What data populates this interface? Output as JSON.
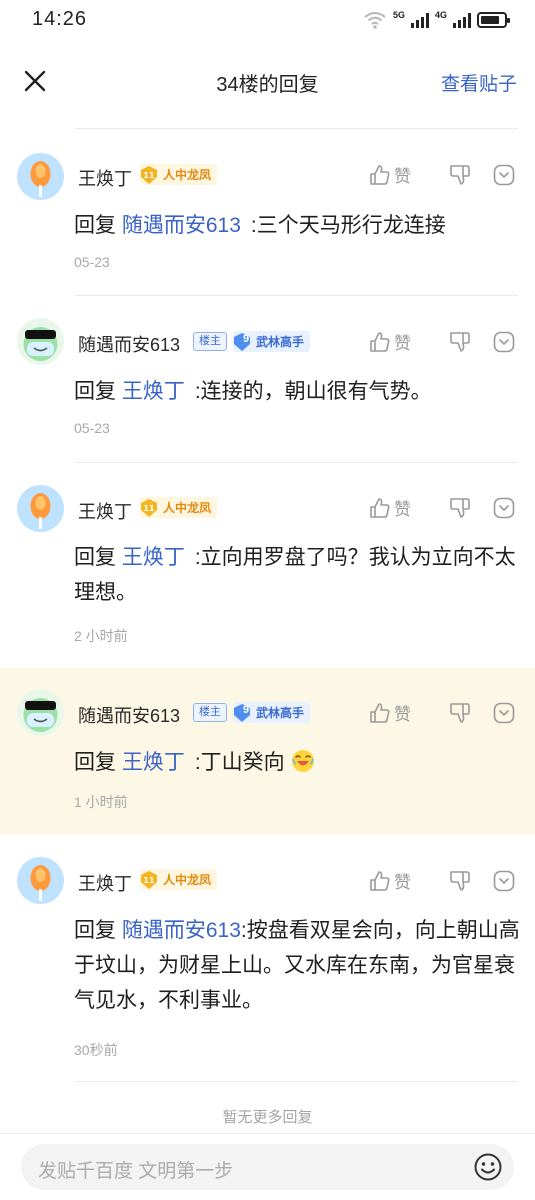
{
  "status": {
    "time": "14:26",
    "net1": "5G",
    "net2": "4G",
    "battery_level": 0.8
  },
  "header": {
    "title": "34楼的回复",
    "action": "查看贴子"
  },
  "replies": [
    {
      "user": "王焕丁",
      "badge": "人中龙凤",
      "reply_word": "回复",
      "mention": "随遇而安613",
      "text": ":三个天马形行龙连接",
      "time": "05-23",
      "like": "赞"
    },
    {
      "user": "随遇而安613",
      "owner_badge": "楼主",
      "level": "9",
      "level_title": "武林高手",
      "reply_word": "回复",
      "mention": "王焕丁",
      "text": ":连接的，朝山很有气势。",
      "time": "05-23",
      "like": "赞"
    },
    {
      "user": "王焕丁",
      "badge": "人中龙凤",
      "reply_word": "回复",
      "mention": "王焕丁",
      "text": ":立向用罗盘了吗？我认为立向不太理想。",
      "time": "2 小时前",
      "like": "赞"
    },
    {
      "user": "随遇而安613",
      "owner_badge": "楼主",
      "level": "9",
      "level_title": "武林高手",
      "reply_word": "回复",
      "mention": "王焕丁",
      "text": ":丁山癸向",
      "time": "1 小时前",
      "like": "赞"
    },
    {
      "user": "王焕丁",
      "badge": "人中龙凤",
      "reply_word": "回复",
      "mention": "随遇而安613",
      "text": ":按盘看双星会向，向上朝山高于坟山，为财星上山。又水库在东南，为官星衰气见水，不利事业。",
      "time": "30秒前",
      "like": "赞"
    }
  ],
  "end_note": "暂无更多回复",
  "composer": {
    "placeholder": "发贴千百度 文明第一步"
  },
  "colors": {
    "link": "#3a63c8",
    "highlight_bg": "#fdf8e6"
  }
}
